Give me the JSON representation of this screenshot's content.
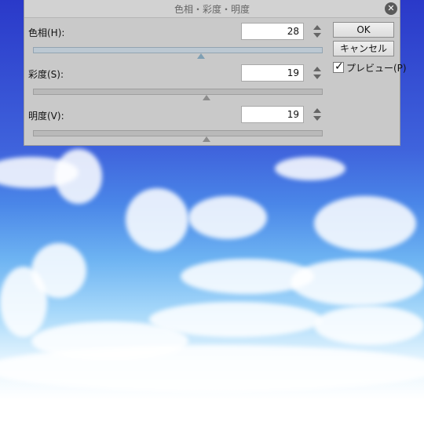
{
  "dialog": {
    "title": "色相・彩度・明度",
    "close_icon": "close-icon",
    "rows": [
      {
        "label": "色相(H):",
        "value": "28",
        "slider_fraction": 0.58
      },
      {
        "label": "彩度(S):",
        "value": "19",
        "slider_fraction": 0.6
      },
      {
        "label": "明度(V):",
        "value": "19",
        "slider_fraction": 0.6
      }
    ],
    "ok_label": "OK",
    "cancel_label": "キャンセル",
    "preview_label": "プレビュー(P)",
    "preview_checked": true
  }
}
